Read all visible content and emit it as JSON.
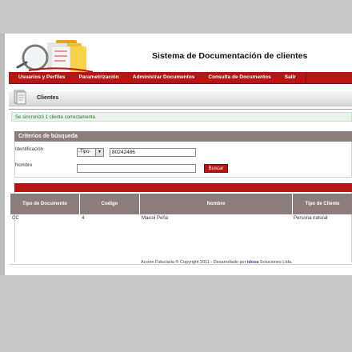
{
  "app": {
    "title": "Sistema de Documentación de clientes"
  },
  "nav": {
    "items": [
      "Usuarios y Perfiles",
      "Parametrización",
      "Administrar Documentos",
      "Consulta de Documentos",
      "Salir"
    ]
  },
  "section": {
    "title": "Clientes"
  },
  "message": "Se sincronizó 1 cliente correctamente.",
  "criteria": {
    "title": "Criterios de búsqueda",
    "id_label": "Identificación",
    "type_selected": "-Tipo-",
    "id_value": "80242486",
    "name_label": "Nombre",
    "name_value": "",
    "search_button": "Buscar"
  },
  "table": {
    "headers": [
      "Tipo de Documento",
      "Codigo",
      "Nombre",
      "Tipo de Cliente"
    ],
    "rows": [
      [
        "CC",
        "4",
        "Maicol Peña",
        "Persona natural"
      ]
    ]
  },
  "footer": {
    "text": "Acción Fiduciaria ® Copyright 2011 - Desarrollado por",
    "brand_i": "i",
    "brand_rest": "dosa",
    "suffix": "Soluciones Ltda."
  },
  "colors": {
    "brand_red": "#b81414",
    "header_grey": "#8c7d7d"
  }
}
